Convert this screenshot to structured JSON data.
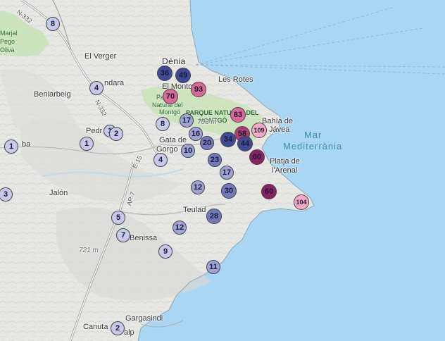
{
  "map": {
    "colors": {
      "sea": "#a9d6f2",
      "land": "#e9e9e6",
      "park": "#c9e3b8",
      "c1": "#c7c9ea",
      "c2": "#9fa3d8",
      "c3": "#7279bd",
      "c4": "#3f4b96",
      "p1": "#f5a9c9",
      "p2": "#d96a98",
      "p3": "#b13c78",
      "p4": "#8a2165"
    },
    "labels": [
      {
        "id": "majral",
        "text": "Marjal",
        "cls": "park"
      },
      {
        "id": "pego",
        "text": "Pego",
        "cls": "park"
      },
      {
        "id": "oliva",
        "text": "Oliva",
        "cls": "park"
      },
      {
        "id": "n332a",
        "text": "N-332",
        "cls": "road"
      },
      {
        "id": "n332b",
        "text": "N-332",
        "cls": "road"
      },
      {
        "id": "elverger",
        "text": "El Verger",
        "cls": "place"
      },
      {
        "id": "denia",
        "text": "Dénia",
        "cls": "city"
      },
      {
        "id": "lesrotes",
        "text": "Les Rotes",
        "cls": "place"
      },
      {
        "id": "ondara",
        "text": "ndara",
        "cls": "place"
      },
      {
        "id": "elmonto",
        "text": "El Monto",
        "cls": "place"
      },
      {
        "id": "beniarbeig",
        "text": "Beniarbeig",
        "cls": "place"
      },
      {
        "id": "parc",
        "text": "Parc",
        "cls": "park"
      },
      {
        "id": "natural",
        "text": "Natural del",
        "cls": "park"
      },
      {
        "id": "montgo",
        "text": "Montgó",
        "cls": "park"
      },
      {
        "id": "parquenat",
        "text": "PARQUE NATURAL DEL",
        "cls": "parkbold"
      },
      {
        "id": "montgo2",
        "text": "MONTGÓ",
        "cls": "parkbold"
      },
      {
        "id": "bahia",
        "text": "Bahía de",
        "cls": "place"
      },
      {
        "id": "javea",
        "text": "Jávea",
        "cls": "place"
      },
      {
        "id": "mar",
        "text": "Mar",
        "cls": "sea"
      },
      {
        "id": "medi",
        "text": "Mediterrània",
        "cls": "sea"
      },
      {
        "id": "pedr",
        "text": "Pedr",
        "cls": "place"
      },
      {
        "id": "gata",
        "text": "Gata de",
        "cls": "place"
      },
      {
        "id": "gorgo",
        "text": "Gorgo",
        "cls": "place"
      },
      {
        "id": "platja",
        "text": "Platja de",
        "cls": "place"
      },
      {
        "id": "arenal",
        "text": "l'Arenal",
        "cls": "place"
      },
      {
        "id": "ba",
        "text": "ba",
        "cls": "place"
      },
      {
        "id": "jalon",
        "text": "Jalón",
        "cls": "place"
      },
      {
        "id": "ap7",
        "text": "AP-7",
        "cls": "road"
      },
      {
        "id": "e15",
        "text": "E-15",
        "cls": "road"
      },
      {
        "id": "teulad",
        "text": "Teulad",
        "cls": "place"
      },
      {
        "id": "benissa",
        "text": "Benissa",
        "cls": "place"
      },
      {
        "id": "m721",
        "text": "721 m",
        "cls": "elev"
      },
      {
        "id": "m753",
        "text": "753 m",
        "cls": "elev"
      },
      {
        "id": "gargasindi",
        "text": "Gargasindi",
        "cls": "place"
      },
      {
        "id": "canuta",
        "text": "Canuta",
        "cls": "place"
      },
      {
        "id": "alp",
        "text": "alp",
        "cls": "place"
      }
    ],
    "markers": [
      {
        "id": "m1",
        "value": "8",
        "tone": "c1"
      },
      {
        "id": "m2",
        "value": "36",
        "tone": "c4"
      },
      {
        "id": "m3",
        "value": "49",
        "tone": "c4"
      },
      {
        "id": "m4",
        "value": "4",
        "tone": "c1"
      },
      {
        "id": "m5",
        "value": "70",
        "tone": "p2"
      },
      {
        "id": "m6",
        "value": "93",
        "tone": "p2"
      },
      {
        "id": "m7",
        "value": "83",
        "tone": "p2"
      },
      {
        "id": "m8",
        "value": "8",
        "tone": "c1"
      },
      {
        "id": "m9",
        "value": "17",
        "tone": "c2"
      },
      {
        "id": "m10",
        "value": "16",
        "tone": "c2"
      },
      {
        "id": "m11",
        "value": "58",
        "tone": "p3"
      },
      {
        "id": "m12",
        "value": "109",
        "tone": "p1"
      },
      {
        "id": "m13",
        "value": "1",
        "tone": "c1"
      },
      {
        "id": "m14",
        "value": "2",
        "tone": "c1"
      },
      {
        "id": "m15",
        "value": "1",
        "tone": "c1"
      },
      {
        "id": "m16",
        "value": "20",
        "tone": "c3"
      },
      {
        "id": "m17",
        "value": "34",
        "tone": "c4"
      },
      {
        "id": "m18",
        "value": "44",
        "tone": "c4"
      },
      {
        "id": "m19",
        "value": "10",
        "tone": "c2"
      },
      {
        "id": "m20",
        "value": "4",
        "tone": "c1"
      },
      {
        "id": "m21",
        "value": "60",
        "tone": "p4"
      },
      {
        "id": "m22",
        "value": "23",
        "tone": "c3"
      },
      {
        "id": "m23",
        "value": "17",
        "tone": "c2"
      },
      {
        "id": "m24",
        "value": "1",
        "tone": "c1"
      },
      {
        "id": "m25",
        "value": "3",
        "tone": "c1"
      },
      {
        "id": "m26",
        "value": "12",
        "tone": "c2"
      },
      {
        "id": "m27",
        "value": "30",
        "tone": "c3"
      },
      {
        "id": "m28",
        "value": "60",
        "tone": "p4"
      },
      {
        "id": "m29",
        "value": "104",
        "tone": "p1"
      },
      {
        "id": "m30",
        "value": "5",
        "tone": "c1"
      },
      {
        "id": "m31",
        "value": "28",
        "tone": "c3"
      },
      {
        "id": "m32",
        "value": "7",
        "tone": "c1"
      },
      {
        "id": "m33",
        "value": "12",
        "tone": "c2"
      },
      {
        "id": "m34",
        "value": "9",
        "tone": "c1"
      },
      {
        "id": "m35",
        "value": "11",
        "tone": "c2"
      },
      {
        "id": "m36",
        "value": "2",
        "tone": "c1"
      }
    ]
  }
}
